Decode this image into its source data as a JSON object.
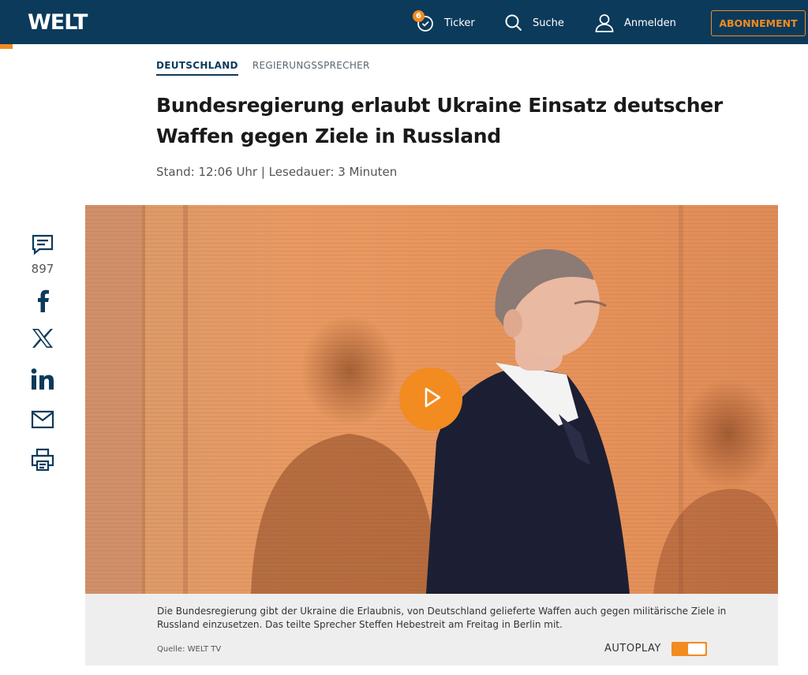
{
  "header": {
    "logo": "WELT",
    "ticker_label": "Ticker",
    "ticker_badge": "6",
    "search_label": "Suche",
    "login_label": "Anmelden",
    "subscribe_label": "ABONNEMENT"
  },
  "breadcrumb": {
    "primary": "DEUTSCHLAND",
    "secondary": "REGIERUNGSSPRECHER"
  },
  "article": {
    "headline": "Bundesregierung erlaubt Ukraine Einsatz deutscher Waffen gegen Ziele in Russland",
    "meta": "Stand: 12:06 Uhr | Lesedauer: 3 Minuten"
  },
  "share": {
    "comment_count": "897"
  },
  "video": {
    "caption": "Die Bundesregierung gibt der Ukraine die Erlaubnis, von Deutschland gelieferte Waffen auch gegen militärische Ziele in Russland einzusetzen. Das teilte Sprecher Steffen Hebestreit am Freitag in Berlin mit.",
    "source": "Quelle: WELT TV",
    "autoplay_label": "AUTOPLAY",
    "autoplay_on": true
  },
  "colors": {
    "brand_navy": "#0c3a5b",
    "accent_orange": "#f28b20",
    "caption_bg": "#eeeeee"
  }
}
